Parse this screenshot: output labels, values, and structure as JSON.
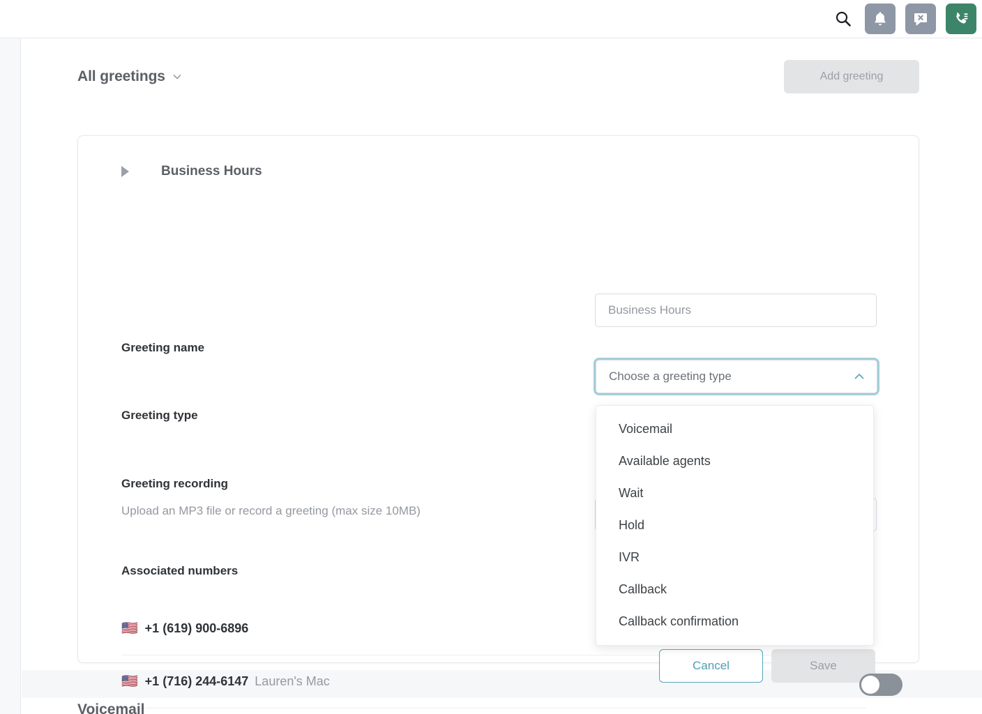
{
  "topbar": {
    "icons": [
      {
        "name": "search-icon",
        "label": "Search"
      },
      {
        "name": "notifications-icon",
        "label": "Notifications"
      },
      {
        "name": "message-dismiss-icon",
        "label": "Messages"
      },
      {
        "name": "phone-keypad-icon",
        "label": "Call"
      }
    ],
    "colors": {
      "grey_button": "#8e97a5",
      "green_button": "#3d8568"
    }
  },
  "page": {
    "title": "All greetings",
    "title_caret": "chevron-down-icon",
    "add_button_label": "Add greeting",
    "add_button_disabled": true
  },
  "card": {
    "expander_icon": "triangle-right-icon",
    "title": "Business Hours",
    "greeting_name": {
      "label": "Greeting name",
      "value": "",
      "placeholder": "Business Hours"
    },
    "greeting_type": {
      "label": "Greeting type",
      "selected_text": "Choose a greeting type",
      "chevron": "chevron-up-icon",
      "expanded": true,
      "options": [
        "Voicemail",
        "Available agents",
        "Wait",
        "Hold",
        "IVR",
        "Callback",
        "Callback confirmation"
      ],
      "focus_ring_color": "#a3ced9"
    },
    "greeting_recording": {
      "label": "Greeting recording",
      "description": "Upload an MP3 file or record a greeting (max size 10MB)"
    },
    "associated_numbers": {
      "label": "Associated numbers",
      "rows": [
        {
          "flag": "🇺🇸",
          "number": "+1 (619) 900-6896",
          "device": ""
        },
        {
          "flag": "🇺🇸",
          "number": "+1 (716) 244-6147",
          "device": "Lauren's Mac"
        }
      ],
      "toggle_state": "off"
    },
    "footer": {
      "cancel_label": "Cancel",
      "save_label": "Save",
      "save_disabled": true,
      "cancel_color": "#4f9fb6"
    }
  },
  "next_section": {
    "title": "Voicemail"
  }
}
